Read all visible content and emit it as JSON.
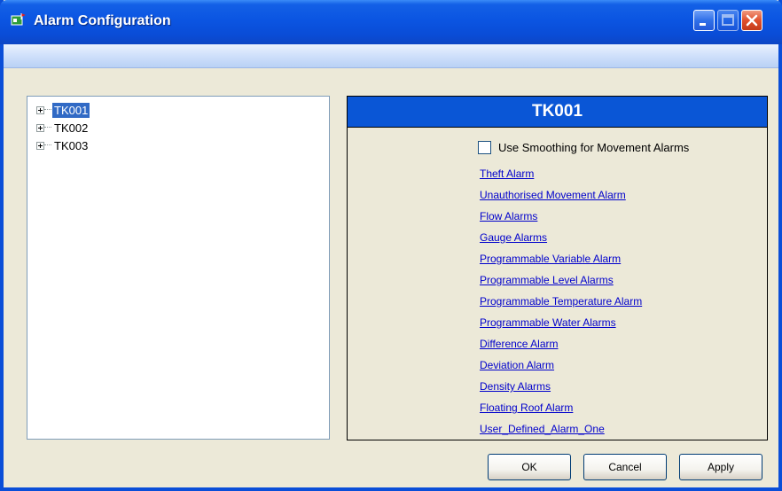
{
  "window": {
    "title": "Alarm Configuration"
  },
  "tree": {
    "items": [
      {
        "label": "TK001",
        "selected": true
      },
      {
        "label": "TK002",
        "selected": false
      },
      {
        "label": "TK003",
        "selected": false
      }
    ]
  },
  "detail": {
    "header": "TK001",
    "smoothing_label": "Use Smoothing for Movement Alarms",
    "smoothing_checked": false,
    "links": [
      "Theft Alarm",
      "Unauthorised Movement Alarm",
      "Flow Alarms",
      "Gauge Alarms",
      "Programmable Variable Alarm",
      "Programmable Level Alarms",
      "Programmable Temperature Alarm",
      "Programmable Water Alarms",
      "Difference Alarm",
      "Deviation Alarm",
      "Density Alarms",
      "Floating Roof Alarm",
      "User_Defined_Alarm_One"
    ]
  },
  "buttons": {
    "ok": "OK",
    "cancel": "Cancel",
    "apply": "Apply"
  },
  "colors": {
    "titlebar": "#0a4cd6",
    "header": "#0a56d6",
    "link": "#0000cc",
    "selection": "#316ac5"
  }
}
